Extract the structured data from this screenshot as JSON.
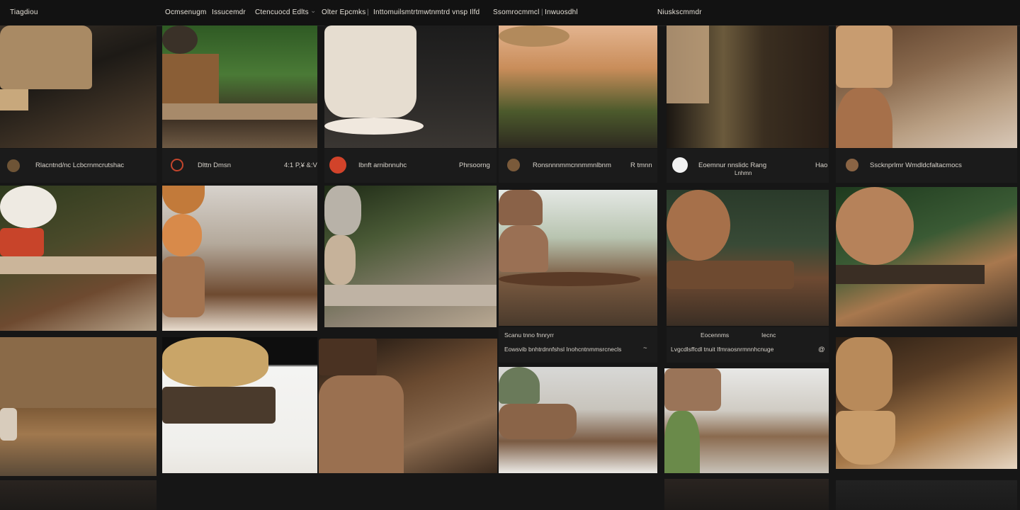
{
  "nav": {
    "logo": "Tiagdiou",
    "items": [
      "Ocmsenugm",
      "Issucemdr",
      "Ctencuocd Edlts",
      "Olter Epcmks",
      "Inttomuilsmtrtmwtnmtrd vnsp Ilfd",
      "Ssomrocmmcl",
      "Inwuosdhl"
    ],
    "right": "Niuskscmmdr"
  },
  "tiles": [
    {
      "name": "tile-armchair-wicker",
      "gradient": "g1"
    },
    {
      "name": "tile-plant-pots",
      "gradient": "g2"
    },
    {
      "name": "tile-white-vessel",
      "gradient": "g3"
    },
    {
      "name": "tile-sunset-basket",
      "gradient": "g4"
    },
    {
      "name": "tile-leather-stand",
      "gradient": "g5"
    },
    {
      "name": "tile-copper-vases",
      "gradient": "g6"
    },
    {
      "name": "tile-flower-bench",
      "gradient": "g7"
    },
    {
      "name": "tile-kitchen-bowls",
      "gradient": "g8"
    },
    {
      "name": "tile-garden-pottery",
      "gradient": "g9"
    },
    {
      "name": "tile-glass-bags",
      "gradient": "g10"
    },
    {
      "name": "tile-copper-kettle",
      "gradient": "g11"
    },
    {
      "name": "tile-glass-globe",
      "gradient": "g12"
    },
    {
      "name": "tile-warm-interior",
      "gradient": "g13"
    },
    {
      "name": "tile-flower-tray",
      "gradient": "g14"
    },
    {
      "name": "tile-leather-case",
      "gradient": "g15"
    },
    {
      "name": "tile-soft-bag",
      "gradient": "g16"
    },
    {
      "name": "tile-basket-setup",
      "gradient": "g17"
    },
    {
      "name": "tile-wooden-pots",
      "gradient": "g18"
    },
    {
      "name": "tile-bottom-left",
      "gradient": "g19"
    },
    {
      "name": "tile-bottom-right",
      "gradient": "g20"
    }
  ],
  "captions": {
    "c1": {
      "text": "Rlacntnd/nc Lcbcrnmcrutshac"
    },
    "c2": {
      "title": "Dlttn Dmsn",
      "meta": "4:1 P,¥ &:V"
    },
    "c3": {
      "title": "Ibnft arnibnnuhc",
      "meta": "Phrsoorng"
    },
    "c4": {
      "title": "Ronsnnnmmcnnmmnlbnm",
      "meta": "R tmnn"
    },
    "c5": {
      "title": "Eoemnur nnslidc Rang",
      "sub": "Lnhmn",
      "meta": "Hao"
    },
    "c6": {
      "title": "Sscknprlmr Wmdldcfaltacmocs"
    },
    "c7": {
      "title": "Scanu tnno fnnryrr",
      "sub": "Eowsvib  bnhtrdnnfshsl  Inohcntnmmsrcnecls",
      "meta": "~"
    },
    "c8": {
      "title": "Eocennms",
      "title2": "Iecnc",
      "sub": "Lvgcdlsffcdl tnuit  Ifmraosnrmnnhcnuge",
      "meta": "@"
    }
  },
  "colors": {
    "bg": "#161616",
    "accent_red": "#d2432a",
    "caption_bg": "#1b1b1b"
  }
}
